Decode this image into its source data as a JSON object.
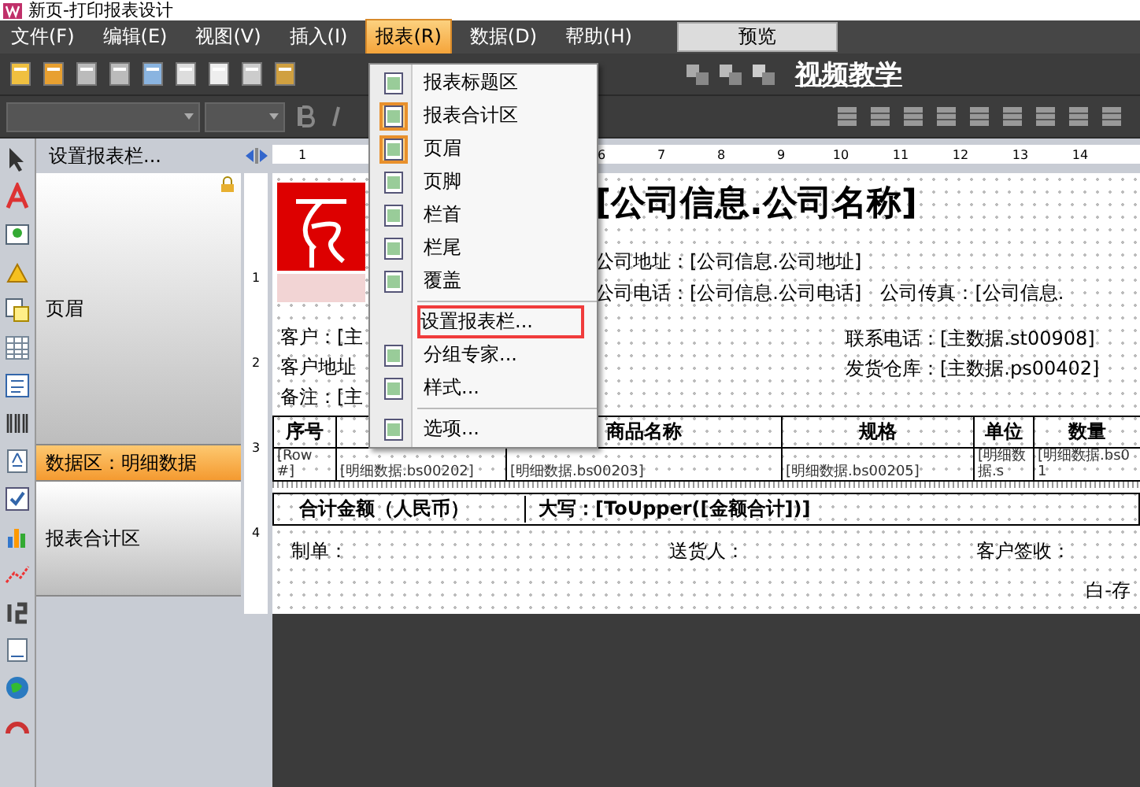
{
  "window": {
    "title": "新页-打印报表设计"
  },
  "menu_bar": [
    {
      "label": "文件(F)",
      "selected": false
    },
    {
      "label": "编辑(E)",
      "selected": false
    },
    {
      "label": "视图(V)",
      "selected": false
    },
    {
      "label": "插入(I)",
      "selected": false
    },
    {
      "label": "报表(R)",
      "selected": true
    },
    {
      "label": "数据(D)",
      "selected": false
    },
    {
      "label": "帮助(H)",
      "selected": false
    }
  ],
  "preview_button": "预览",
  "toolbar": {
    "video_link": "视频教学"
  },
  "band_panel": {
    "header": "设置报表栏...",
    "bands": [
      {
        "label": "页眉",
        "kind": "header",
        "selected": false
      },
      {
        "label": "数据区：明细数据",
        "kind": "data",
        "selected": true
      },
      {
        "label": "报表合计区",
        "kind": "summary",
        "selected": false
      }
    ]
  },
  "rulers": {
    "horizontal": [
      "1",
      "6",
      "7",
      "8",
      "9",
      "10",
      "11",
      "12",
      "13",
      "14"
    ],
    "vertical": [
      "1",
      "2",
      "3",
      "4"
    ]
  },
  "report": {
    "title": "[公司信息.公司名称]",
    "company_lines": [
      [
        "公司地址：[公司信息.公司地址]"
      ],
      [
        "公司电话：[公司信息.公司电话]",
        "公司传真：[公司信息."
      ]
    ],
    "left_fields": [
      "客户：[主",
      "客户地址",
      "备注：[主"
    ],
    "right_fields": [
      "联系电话：[主数据.st00908]",
      "发货仓库：[主数据.ps00402]"
    ],
    "table": {
      "columns": [
        {
          "header": "序号"
        },
        {},
        {
          "header": "商品名称"
        },
        {
          "header": "规格"
        },
        {
          "header": "单位"
        },
        {
          "header": "数量"
        }
      ],
      "row": [
        "[Row #]",
        "[明细数据.bs00202]",
        "[明细数据.bs00203]",
        "[明细数据.bs00205]",
        "[明细数据.s",
        "[明细数据.bs01"
      ]
    },
    "summary": [
      "合计金额（人民币）",
      "大写：[ToUpper([金额合计])]"
    ],
    "signatures": [
      "制单：",
      "送货人：",
      "客户签收："
    ],
    "note": "白-存"
  },
  "dropdown_menu": [
    {
      "kind": "item",
      "label": "报表标题区",
      "checked": false,
      "highlighted": false
    },
    {
      "kind": "item",
      "label": "报表合计区",
      "checked": true,
      "highlighted": false
    },
    {
      "kind": "item",
      "label": "页眉",
      "checked": true,
      "highlighted": false
    },
    {
      "kind": "item",
      "label": "页脚",
      "checked": false,
      "highlighted": false
    },
    {
      "kind": "item",
      "label": "栏首",
      "checked": false,
      "highlighted": false
    },
    {
      "kind": "item",
      "label": "栏尾",
      "checked": false,
      "highlighted": false
    },
    {
      "kind": "item",
      "label": "覆盖",
      "checked": false,
      "highlighted": false
    },
    {
      "kind": "separator"
    },
    {
      "kind": "item",
      "label": "设置报表栏...",
      "highlighted": true
    },
    {
      "kind": "item",
      "label": "分组专家...",
      "checked": false,
      "highlighted": false
    },
    {
      "kind": "item",
      "label": "样式...",
      "checked": false,
      "highlighted": false
    },
    {
      "kind": "separator"
    },
    {
      "kind": "item",
      "label": "选项...",
      "checked": false,
      "highlighted": false
    }
  ]
}
